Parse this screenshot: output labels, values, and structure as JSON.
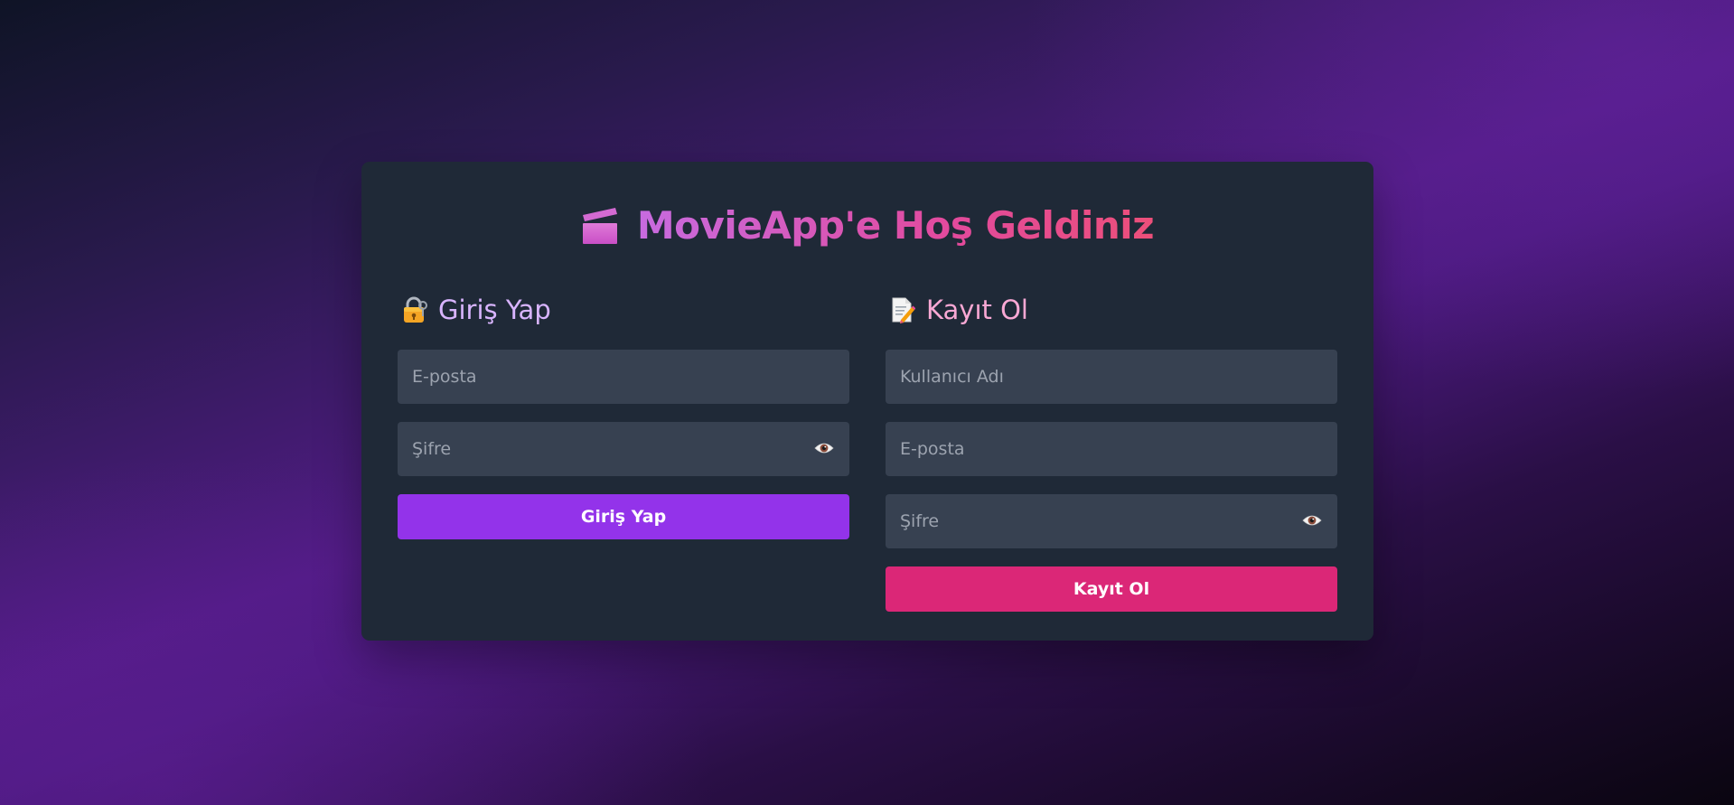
{
  "page": {
    "title": "MovieApp'e Hoş Geldiniz",
    "title_icon": "clapper-board-icon"
  },
  "login": {
    "heading": "Giriş Yap",
    "heading_icon": "lock-with-key-icon",
    "email_placeholder": "E-posta",
    "password_placeholder": "Şifre",
    "password_toggle_icon": "eye-icon",
    "submit_label": "Giriş Yap"
  },
  "register": {
    "heading": "Kayıt Ol",
    "heading_icon": "memo-icon",
    "username_placeholder": "Kullanıcı Adı",
    "email_placeholder": "E-posta",
    "password_placeholder": "Şifre",
    "password_toggle_icon": "eye-icon",
    "submit_label": "Kayıt Ol"
  },
  "colors": {
    "card_bg": "#1f2937",
    "input_bg": "#374151",
    "login_accent": "#9333ea",
    "register_accent": "#db2777",
    "login_heading": "#d8b4fe",
    "register_heading": "#f9a8d4"
  }
}
